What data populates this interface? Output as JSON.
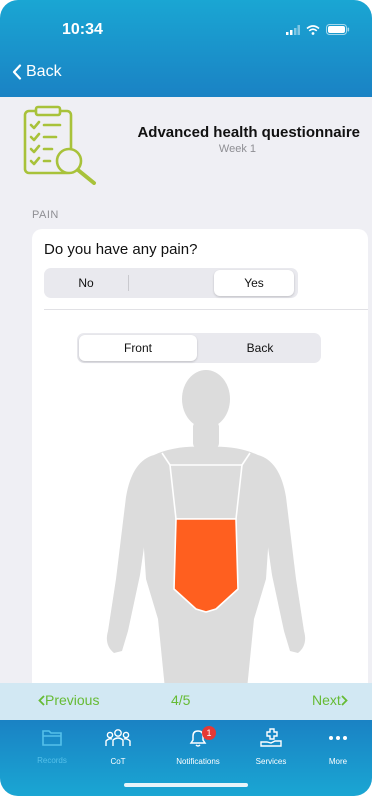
{
  "status_bar": {
    "time": "10:34"
  },
  "nav": {
    "back_label": "Back"
  },
  "header": {
    "title": "Advanced health questionnaire",
    "subtitle": "Week 1"
  },
  "section": {
    "label": "PAIN"
  },
  "question": {
    "text": "Do you have any pain?",
    "options": [
      "No",
      "Yes"
    ],
    "selected": "Yes"
  },
  "view_toggle": {
    "options": [
      "Front",
      "Back"
    ],
    "selected": "Front"
  },
  "body_map": {
    "highlighted_area": "abdomen",
    "highlight_color": "#ff5f1f",
    "body_color": "#dcdcdc"
  },
  "pager": {
    "previous": "Previous",
    "position": "4/5",
    "next": "Next"
  },
  "tab_bar": {
    "items": [
      {
        "label": "Records",
        "icon": "folder-icon",
        "active": true
      },
      {
        "label": "CoT",
        "icon": "people-icon",
        "active": false
      },
      {
        "label": "Notifications",
        "icon": "bell-icon",
        "badge": "1",
        "active": false
      },
      {
        "label": "Services",
        "icon": "hand-cross-icon",
        "active": false
      },
      {
        "label": "More",
        "icon": "more-icon",
        "active": false
      }
    ]
  },
  "colors": {
    "primary": "#1a94cc",
    "accent_green": "#66bb34",
    "clipboard": "#a8c23a"
  }
}
